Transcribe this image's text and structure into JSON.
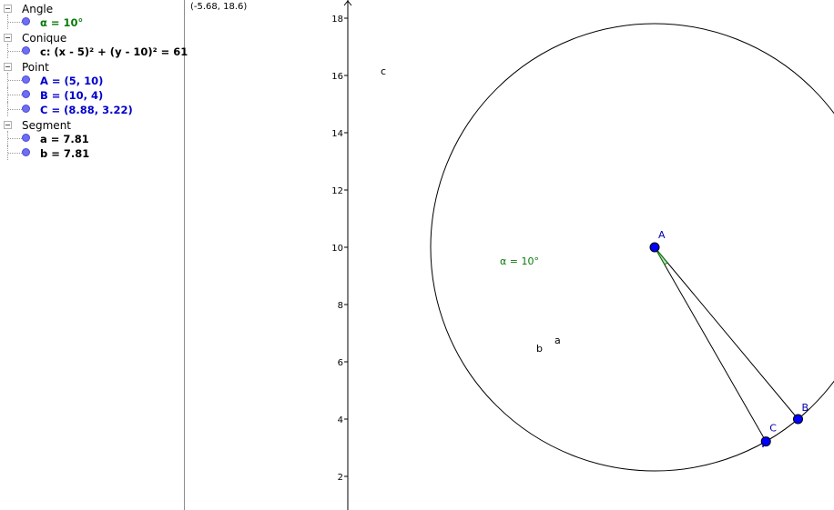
{
  "algebra": {
    "groups": [
      {
        "label": "Angle",
        "items": [
          {
            "text": "α = 10°",
            "color": "#0a7a0a"
          }
        ]
      },
      {
        "label": "Conique",
        "items": [
          {
            "text": "c: (x - 5)² + (y - 10)² = 61",
            "color": "#000000"
          }
        ]
      },
      {
        "label": "Point",
        "items": [
          {
            "text": "A = (5, 10)",
            "color": "#0000cc"
          },
          {
            "text": "B = (10, 4)",
            "color": "#0000cc"
          },
          {
            "text": "C = (8.88, 3.22)",
            "color": "#0000cc"
          }
        ]
      },
      {
        "label": "Segment",
        "items": [
          {
            "text": "a = 7.81",
            "color": "#000000"
          },
          {
            "text": "b = 7.81",
            "color": "#000000"
          }
        ]
      }
    ]
  },
  "graphics": {
    "coord_readout": "(-5.68, 18.6)",
    "y_ticks": [
      "2",
      "4",
      "6",
      "8",
      "10",
      "12",
      "14",
      "16",
      "18"
    ],
    "circle_label": "c",
    "angle_label": "α = 10°",
    "angle_color": "#0a7a0a",
    "point_color": "#0000ff",
    "point_label_color": "#0000aa",
    "points": [
      {
        "name": "A",
        "x": 5,
        "y": 10
      },
      {
        "name": "B",
        "x": 10,
        "y": 4
      },
      {
        "name": "C",
        "x": 8.88,
        "y": 3.22
      }
    ],
    "circle": {
      "cx": 5,
      "cy": 10,
      "r": 7.81
    },
    "segments": [
      {
        "name": "a",
        "from": "A",
        "to": "B"
      },
      {
        "name": "b",
        "from": "A",
        "to": "C"
      }
    ]
  }
}
